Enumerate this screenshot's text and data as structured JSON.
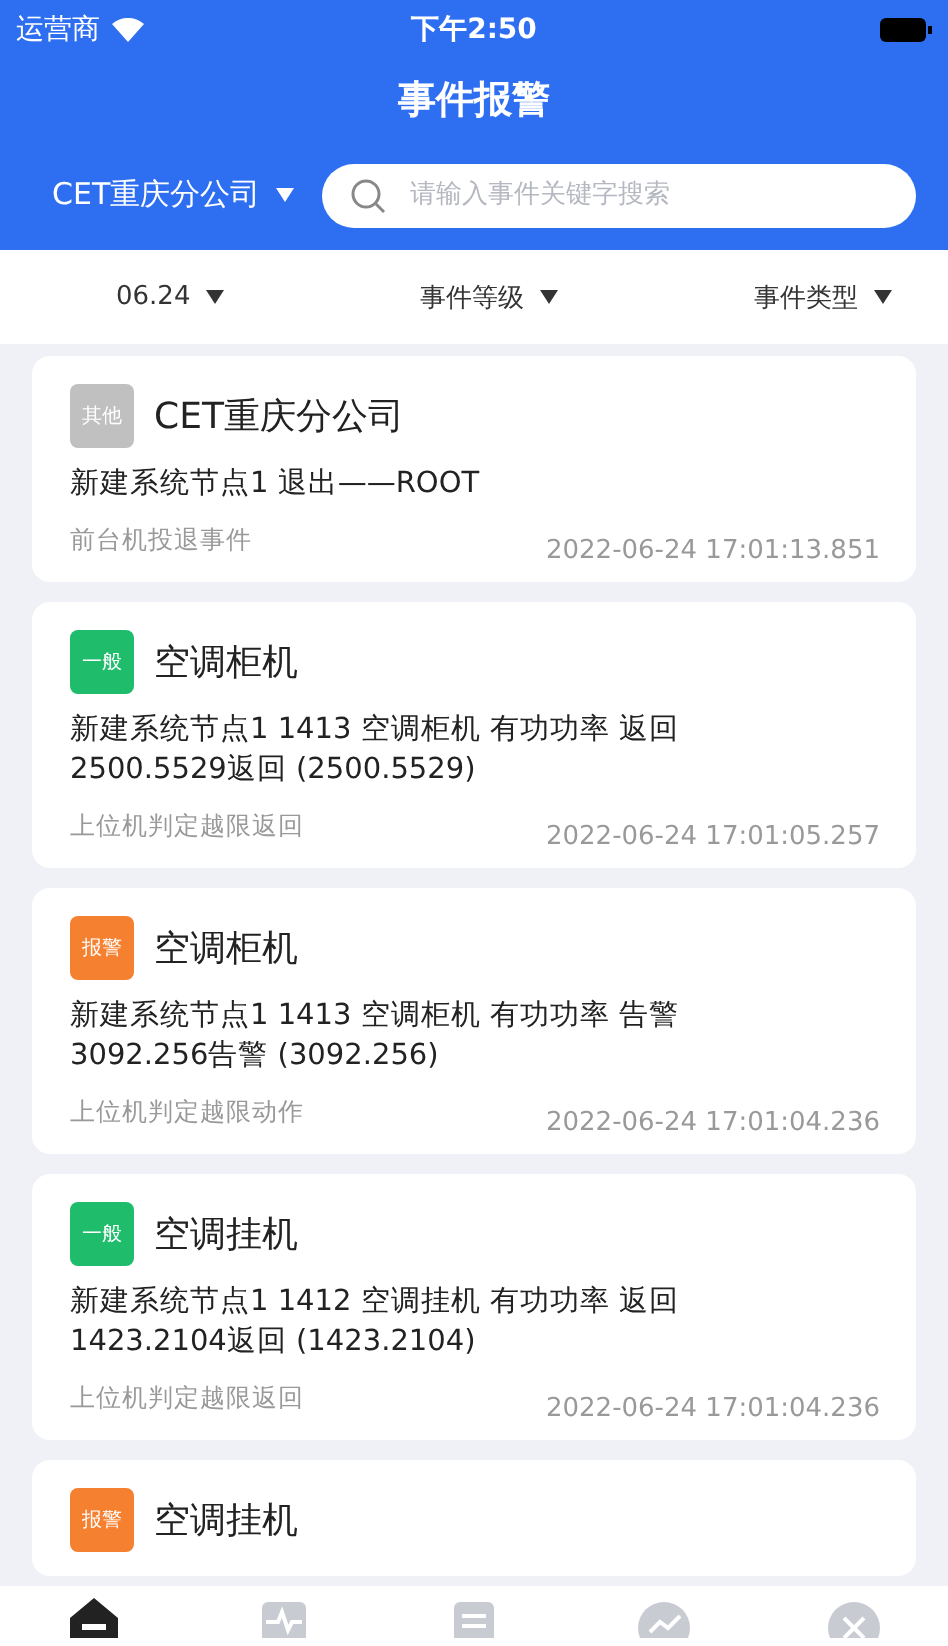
{
  "status_bar": {
    "carrier": "运营商",
    "time": "下午2:50"
  },
  "header": {
    "title": "事件报警",
    "company": "CET重庆分公司",
    "search": {
      "placeholder": "请输入事件关键字搜索"
    }
  },
  "filters": [
    {
      "label": "06.24"
    },
    {
      "label": "事件等级"
    },
    {
      "label": "事件类型"
    }
  ],
  "events": [
    {
      "level": "其他",
      "kind": "other",
      "title": "CET重庆分公司",
      "description": "新建系统节点1 退出——ROOT",
      "source": "前台机投退事件",
      "time": "2022-06-24 17:01:13.851"
    },
    {
      "level": "一般",
      "kind": "normal",
      "title": "空调柜机",
      "description": "新建系统节点1 1413 空调柜机 有功功率 返回 2500.5529返回 (2500.5529)",
      "source": "上位机判定越限返回",
      "time": "2022-06-24 17:01:05.257"
    },
    {
      "level": "报警",
      "kind": "alarm",
      "title": "空调柜机",
      "description": "新建系统节点1 1413 空调柜机 有功功率 告警 3092.256告警 (3092.256)",
      "source": "上位机判定越限动作",
      "time": "2022-06-24 17:01:04.236"
    },
    {
      "level": "一般",
      "kind": "normal",
      "title": "空调挂机",
      "description": "新建系统节点1 1412 空调挂机 有功功率 返回 1423.2104返回 (1423.2104)",
      "source": "上位机判定越限返回",
      "time": "2022-06-24 17:01:04.236"
    },
    {
      "level": "报警",
      "kind": "alarm",
      "title": "空调挂机"
    }
  ],
  "tab_bar": [
    {
      "kind": "home",
      "selected": true
    },
    {
      "kind": "pulse",
      "selected": false
    },
    {
      "kind": "list",
      "selected": false
    },
    {
      "kind": "chart",
      "selected": false
    },
    {
      "kind": "close",
      "selected": false
    }
  ]
}
